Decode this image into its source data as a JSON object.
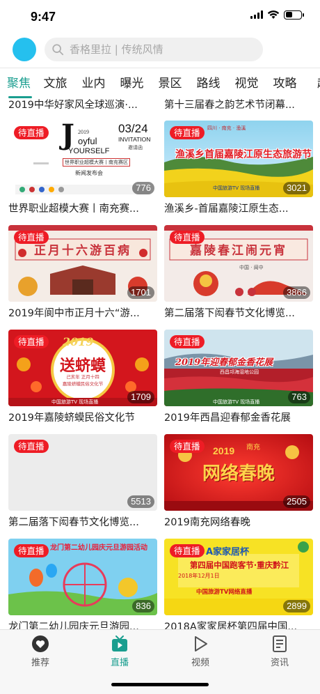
{
  "status_bar": {
    "time": "9:47"
  },
  "search": {
    "placeholder": "香格里拉 | 传统风情"
  },
  "tabs": [
    {
      "label": "聚焦"
    },
    {
      "label": "文旅"
    },
    {
      "label": "业内"
    },
    {
      "label": "曝光"
    },
    {
      "label": "景区"
    },
    {
      "label": "路线"
    },
    {
      "label": "视觉"
    },
    {
      "label": "攻略"
    },
    {
      "label": "超"
    }
  ],
  "partial_row": [
    {
      "title": "2019中华好家风全球巡演·..."
    },
    {
      "title": "第十三届春之韵艺术节闭幕..."
    }
  ],
  "badge_label": "待直播",
  "cards": [
    {
      "title": "世界职业超模大赛丨南充赛...",
      "count": "776",
      "poster": {
        "line1": "oyful",
        "line2": "YOURSELF",
        "year": "2019",
        "date": "03/24",
        "invite": "INVITATION",
        "invite_cn": "邀请函",
        "subtitle": "世界职业超模大赛丨南充赛区",
        "caption": "新闻发布会"
      }
    },
    {
      "title": "渔溪乡-首届嘉陵江原生态...",
      "count": "3021",
      "poster": {
        "top": "四川 · 南充 · 渔溪",
        "headline": "渔溪乡首届嘉陵江原生态旅游节",
        "footer": "中国旅游TV 现场直播"
      }
    },
    {
      "title": "2019年阆中市正月十六“游...",
      "count": "1701",
      "poster": {
        "headline": "正月十六游百病"
      }
    },
    {
      "title": "第二届落下闳春节文化博览...",
      "count": "3866",
      "poster": {
        "headline": "嘉陵春江闹元宵",
        "sub": "中国 · 阆中"
      }
    },
    {
      "title": "2019年嘉陵蛴蟆民俗文化节",
      "count": "1709",
      "poster": {
        "year": "2019",
        "headline": "送蛴蟆",
        "sub": "己亥年 正月十四",
        "sub2": "嘉陵蛴蟆民俗文化节",
        "footer": "中国旅游TV 现场直播"
      }
    },
    {
      "title": "2019年西昌迎春郁金香花展",
      "count": "763",
      "poster": {
        "headline": "2019年迎春郁金香花展",
        "sub": "西昌邛海湿地公园",
        "footer": "中国旅游TV 现场直播"
      }
    },
    {
      "title": "第二届落下闳春节文化博览...",
      "count": "5513",
      "poster": {}
    },
    {
      "title": "2019南充网络春晚",
      "count": "2505",
      "poster": {
        "year": "2019",
        "top": "南充",
        "headline": "网络春晚"
      }
    },
    {
      "title": "龙门第二幼儿园庆元旦游园...",
      "count": "836",
      "poster": {
        "headline": "龙门第二幼儿园庆元旦游园活动"
      }
    },
    {
      "title": "2018A家家居杯第四届中国...",
      "count": "2899",
      "poster": {
        "brand": "A家家居杯",
        "headline": "第四届中国跑客节·重庆黔江",
        "sub": "2018年12月1日",
        "footer": "中国旅游TV网络直播"
      }
    }
  ],
  "tabbar": [
    {
      "label": "推荐",
      "icon": "heart-icon"
    },
    {
      "label": "直播",
      "icon": "tv-icon"
    },
    {
      "label": "视频",
      "icon": "play-icon"
    },
    {
      "label": "资讯",
      "icon": "document-icon"
    }
  ],
  "colors": {
    "accent": "#1a9e8f",
    "badge": "#ee1c25",
    "avatar": "#25c0ee"
  }
}
